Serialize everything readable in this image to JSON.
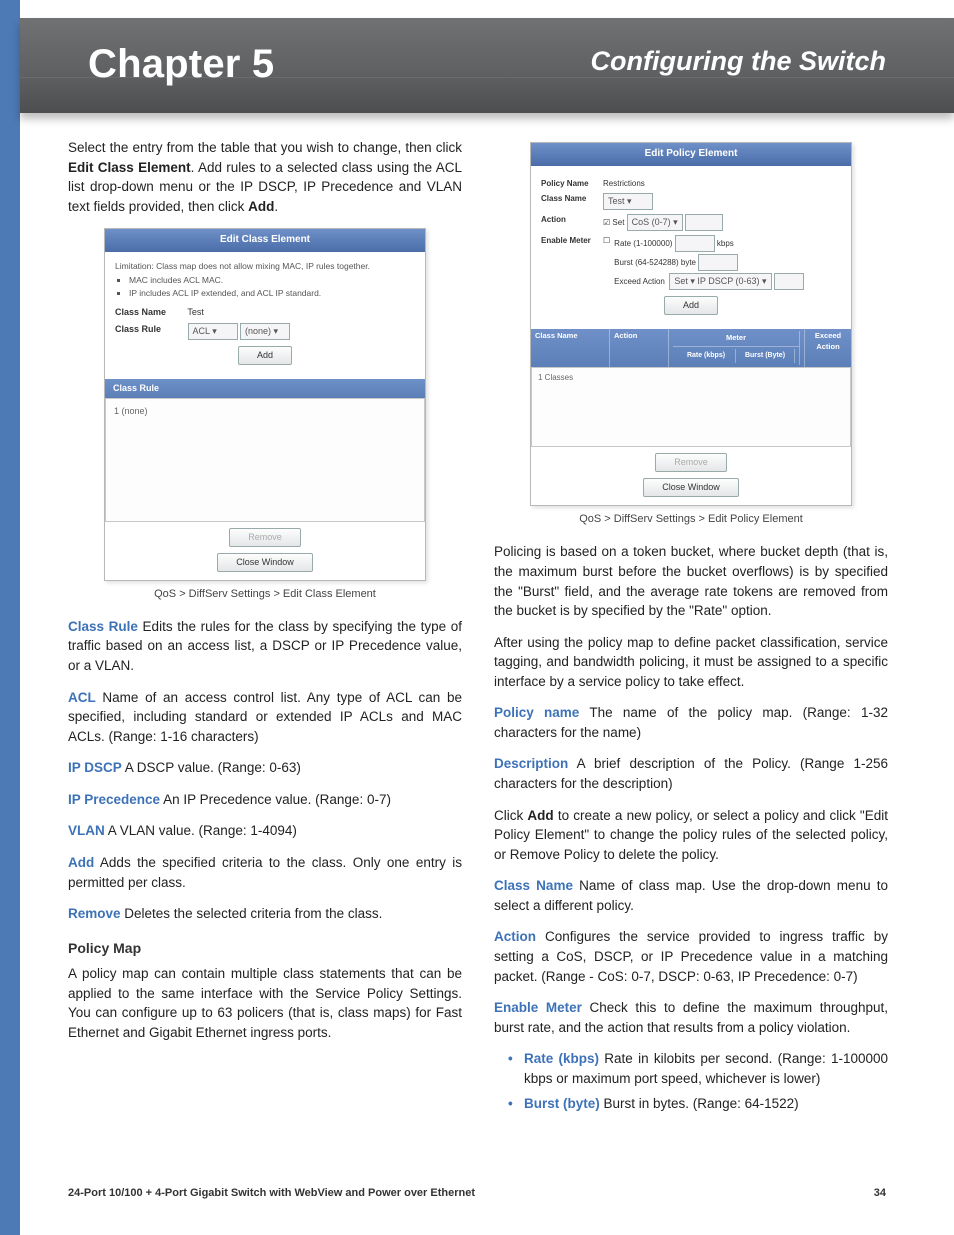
{
  "header": {
    "chapter": "Chapter 5",
    "section": "Configuring the Switch"
  },
  "left": {
    "intro": {
      "part1": "Select the entry from the table that you wish to change, then click ",
      "bold1": "Edit Class Element",
      "part2": ". Add rules to a selected class using the ACL list drop-down menu or the IP DSCP, IP Precedence and VLAN text fields provided, then click ",
      "bold2": "Add",
      "part3": "."
    },
    "mock": {
      "title": "Edit Class Element",
      "limitation": "Limitation: Class map does not allow mixing MAC, IP rules together.",
      "bullet1": "MAC includes ACL MAC.",
      "bullet2": "IP includes ACL IP extended, and ACL IP standard.",
      "className_lbl": "Class Name",
      "className_val": "Test",
      "classRule_lbl": "Class Rule",
      "sel1": "ACL ▾",
      "sel2": "(none) ▾",
      "add_btn": "Add",
      "subhdr": "Class Rule",
      "listitem": "1 (none)",
      "remove_btn": "Remove",
      "close_btn": "Close Window"
    },
    "caption1": "QoS > DiffServ Settings > Edit Class Element",
    "defs": {
      "classRule_t": "Class Rule",
      "classRule_d": "  Edits the rules for the class by specifying the type of traffic based on an access list, a DSCP or IP Precedence value, or a VLAN.",
      "acl_t": "ACL",
      "acl_d": "  Name of an access control list. Any type of ACL can be specified, including standard or extended IP ACLs and MAC ACLs. (Range: 1-16 characters)",
      "ipdscp_t": "IP DSCP",
      "ipdscp_d": "  A DSCP value. (Range: 0-63)",
      "ipprec_t": "IP Precedence",
      "ipprec_d": "  An IP Precedence value. (Range: 0-7)",
      "vlan_t": "VLAN",
      "vlan_d": "  A VLAN value. (Range: 1-4094)",
      "add_t": "Add",
      "add_d": "  Adds the specified criteria to the class. Only one entry is permitted per class.",
      "remove_t": "Remove",
      "remove_d": "  Deletes the selected criteria from the class."
    },
    "policyMap_h": "Policy Map",
    "policyMap_p": "A policy map can contain multiple class statements that can be applied to the same interface with the Service Policy Settings. You can configure up to 63 policers (that is, class maps) for Fast Ethernet and Gigabit Ethernet ingress ports."
  },
  "right": {
    "mock": {
      "title": "Edit Policy Element",
      "policyName_lbl": "Policy Name",
      "policyName_val": "Restrictions",
      "className_lbl": "Class Name",
      "className_val": "Test ▾",
      "action_lbl": "Action",
      "action_chk": "Set",
      "action_sel": "CoS (0-7) ▾",
      "enableMeter_lbl": "Enable Meter",
      "rate_lbl": "Rate (1-100000)",
      "rate_unit": "kbps",
      "burst_lbl": "Burst (64-524288) byte",
      "exceed_lbl": "Exceed Action",
      "exceed_sel": "Set ▾  IP DSCP (0-63) ▾",
      "add_btn": "Add",
      "col1": "Class Name",
      "col2": "Action",
      "col3_top": "Meter",
      "col3a": "Rate (kbps)",
      "col3b": "Burst (Byte)",
      "col4": "Exceed Action",
      "rowitem": "1 Classes",
      "remove_btn": "Remove",
      "close_btn": "Close Window"
    },
    "caption1": "QoS > DiffServ Settings > Edit Policy Element",
    "p_policing": "Policing is based on a token bucket, where bucket depth (that is, the maximum burst before the bucket overflows) is by specified the \"Burst\" field, and the average rate tokens are removed from the bucket is by specified by the \"Rate\" option.",
    "p_after": "After using the policy map to define packet classification, service tagging, and bandwidth policing, it must be assigned to a specific interface by a service policy to take effect.",
    "defs": {
      "policyName_t": "Policy name",
      "policyName_d": "  The name of the policy map. (Range: 1-32 characters for the name)",
      "desc_t": "Description",
      "desc_d": "  A brief description of the Policy. (Range 1-256 characters for the description)"
    },
    "p_clickadd": {
      "a": "Click ",
      "b": "Add",
      "c": " to create a new policy, or select a policy and click \"Edit Policy Element\" to change the policy rules of the selected policy, or Remove Policy to delete the policy."
    },
    "defs2": {
      "className_t": "Class Name",
      "className_d": " Name of class map. Use the drop-down menu to select a different policy.",
      "action_t": "Action",
      "action_d": "  Configures the service provided to ingress traffic by setting a CoS, DSCP, or IP Precedence value in a matching packet. (Range - CoS: 0-7, DSCP: 0-63, IP Precedence: 0-7)",
      "enableMeter_t": "Enable Meter",
      "enableMeter_d": " Check this to define the maximum throughput, burst rate, and the action that results from a policy violation."
    },
    "bullets": {
      "rate_t": "Rate (kbps)",
      "rate_d": "  Rate in kilobits per second. (Range: 1-100000 kbps or maximum port speed, whichever is lower)",
      "burst_t": "Burst (byte)",
      "burst_d": "  Burst in bytes. (Range: 64-1522)"
    }
  },
  "footer": {
    "left": "24-Port 10/100 + 4-Port Gigabit Switch with WebView and Power over Ethernet",
    "right": "34"
  }
}
